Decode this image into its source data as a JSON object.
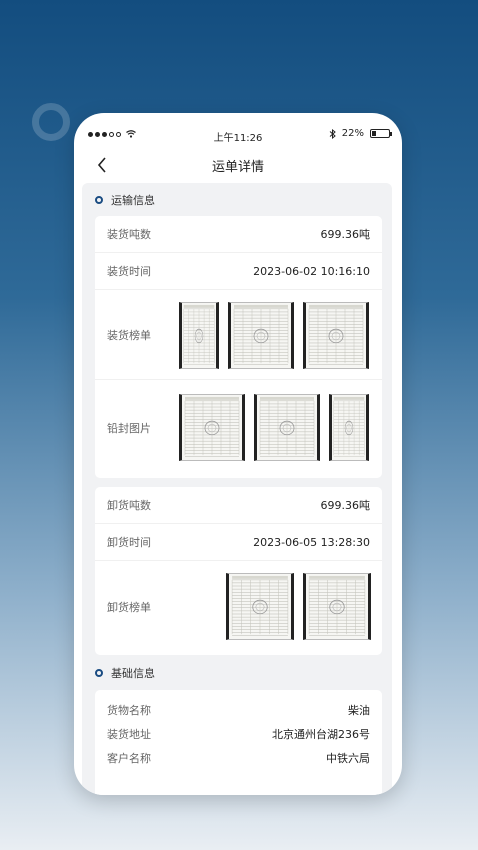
{
  "status": {
    "time": "上午11:26",
    "battery": "22%",
    "battery_level": 0.22
  },
  "nav": {
    "title": "运单详情"
  },
  "transport": {
    "title": "运输信息",
    "load": {
      "tonnage_label": "装货吨数",
      "tonnage_value": "699.36吨",
      "time_label": "装货时间",
      "time_value": "2023-06-02 10:16:10",
      "slip_label": "装货榜单",
      "slip_count": 3,
      "seal_label": "铅封图片",
      "seal_count": 3
    },
    "unload": {
      "tonnage_label": "卸货吨数",
      "tonnage_value": "699.36吨",
      "time_label": "卸货时间",
      "time_value": "2023-06-05 13:28:30",
      "slip_label": "卸货榜单",
      "slip_count": 2
    }
  },
  "basic": {
    "title": "基础信息",
    "cargo_label": "货物名称",
    "cargo_value": "柴油",
    "address_label": "装货地址",
    "address_value": "北京通州台湖236号",
    "customer_label": "客户名称",
    "customer_value": "中铁六局"
  },
  "colors": {
    "accent": "#1a4c82",
    "bg_top": "#134d7f",
    "bg_bottom": "#e9eef3"
  },
  "icons": {
    "back": "chevron-left-icon",
    "bluetooth": "bluetooth-icon",
    "wifi": "wifi-icon"
  }
}
